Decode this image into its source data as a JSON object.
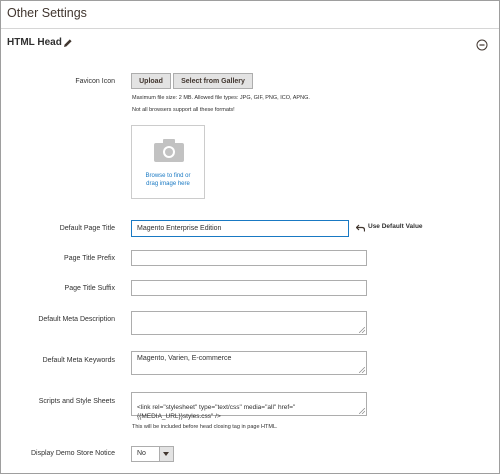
{
  "page": {
    "title": "Other Settings"
  },
  "section": {
    "title": "HTML Head"
  },
  "favicon": {
    "label": "Favicon Icon",
    "upload_label": "Upload",
    "gallery_label": "Select from Gallery",
    "note_line1": "Maximum file size: 2 MB. Allowed file types: JPG, GIF, PNG, ICO, APNG.",
    "note_line2": "Not all browsers support all these formats!",
    "browse_line1": "Browse to find or",
    "browse_line2": "drag image here"
  },
  "default_page_title": {
    "label": "Default Page Title",
    "value": "Magento Enterprise Edition",
    "use_default_label": "Use Default Value"
  },
  "page_title_prefix": {
    "label": "Page Title Prefix",
    "value": ""
  },
  "page_title_suffix": {
    "label": "Page Title Suffix",
    "value": ""
  },
  "default_meta_description": {
    "label": "Default Meta Description",
    "value": ""
  },
  "default_meta_keywords": {
    "label": "Default Meta Keywords",
    "value": "Magento, Varien, E-commerce"
  },
  "scripts_and_style_sheets": {
    "label": "Scripts and Style Sheets",
    "value": "<link  rel=\"stylesheet\" type=\"text/css\"  media=\"all\" href=\"\n{{MEDIA_URL}}styles.css\" />",
    "note": "This will be included before head closing tag in page HTML."
  },
  "display_demo_store_notice": {
    "label": "Display Demo Store Notice",
    "value": "No"
  },
  "colors": {
    "link": "#1979c3",
    "focus_border": "#1979c3",
    "button_bg": "#e3e3e3"
  },
  "icons": {
    "edit": "pencil-icon",
    "collapse": "circle-minus-icon",
    "camera": "camera-icon",
    "undo": "undo-icon"
  }
}
